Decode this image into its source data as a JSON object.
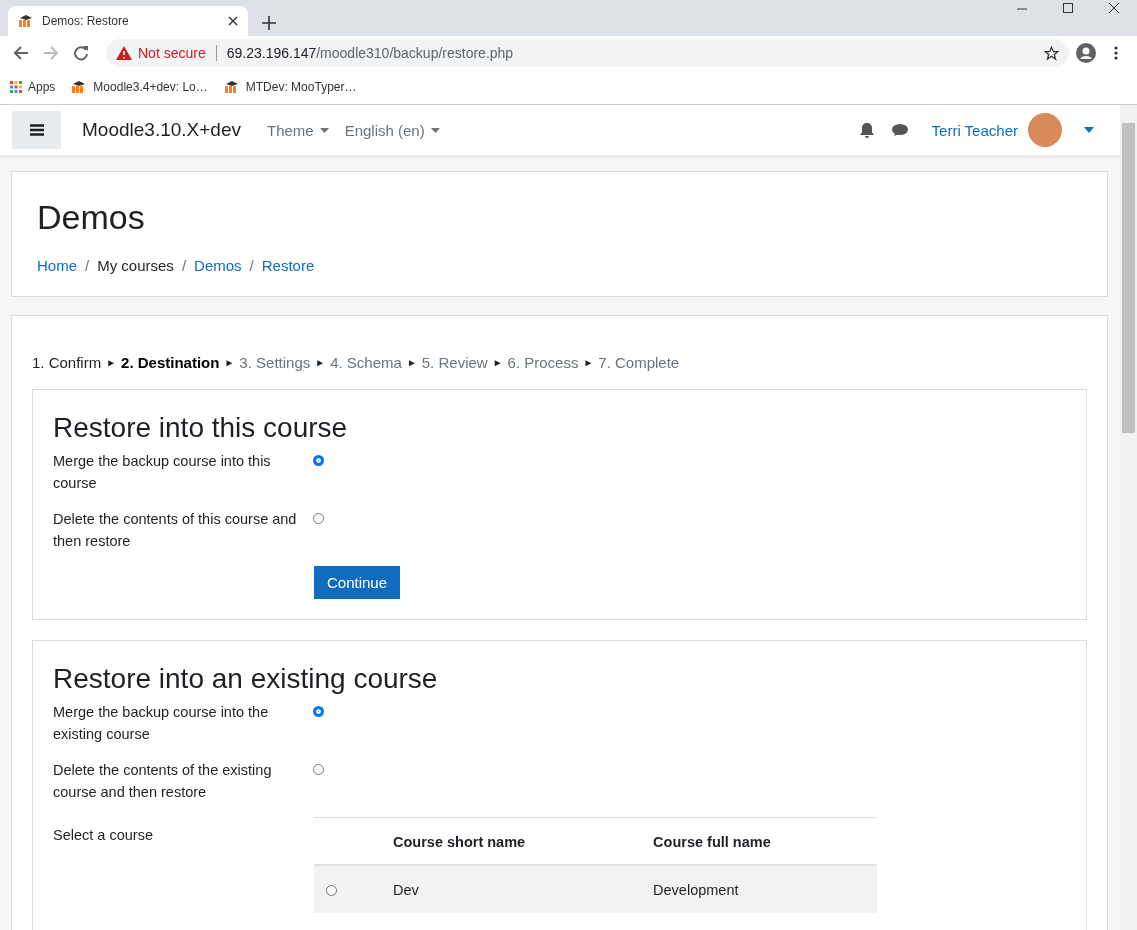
{
  "browser": {
    "tab_title": "Demos: Restore",
    "security": "Not secure",
    "url_host": "69.23.196.147",
    "url_path": "/moodle310/backup/restore.php",
    "bookmarks": [
      "Apps",
      "Moodle3.4+dev: Lo…",
      "MTDev: MooTyper…"
    ]
  },
  "navbar": {
    "site_name": "Moodle3.10.X+dev",
    "menus": [
      "Theme",
      "English (en)"
    ],
    "user_name": "Terri Teacher"
  },
  "header": {
    "title": "Demos",
    "breadcrumb_separator": "/",
    "breadcrumb": [
      {
        "label": "Home",
        "link": true
      },
      {
        "label": "My courses",
        "link": false
      },
      {
        "label": "Demos",
        "link": true
      },
      {
        "label": "Restore",
        "link": true
      }
    ]
  },
  "steps": [
    {
      "label": "1. Confirm",
      "completed": true,
      "selected": false
    },
    {
      "label": "2. Destination",
      "completed": false,
      "selected": true
    },
    {
      "label": "3. Settings",
      "completed": false,
      "selected": false
    },
    {
      "label": "4. Schema",
      "completed": false,
      "selected": false
    },
    {
      "label": "5. Review",
      "completed": false,
      "selected": false
    },
    {
      "label": "6. Process",
      "completed": false,
      "selected": false
    },
    {
      "label": "7. Complete",
      "completed": false,
      "selected": false
    }
  ],
  "step_separator": "►",
  "sections": [
    {
      "title": "Restore into this course",
      "options": [
        {
          "label": "Merge the backup course into this course",
          "selected": true
        },
        {
          "label": "Delete the contents of this course and then restore",
          "selected": false
        }
      ],
      "button": "Continue"
    },
    {
      "title": "Restore into an existing course",
      "options": [
        {
          "label": "Merge the backup course into the existing course",
          "selected": true
        },
        {
          "label": "Delete the contents of the existing course and then restore",
          "selected": false
        }
      ],
      "select_label": "Select a course",
      "table": {
        "columns": [
          "Course short name",
          "Course full name"
        ],
        "rows": [
          {
            "short_name": "Dev",
            "full_name": "Development",
            "selected": false
          }
        ]
      }
    }
  ]
}
